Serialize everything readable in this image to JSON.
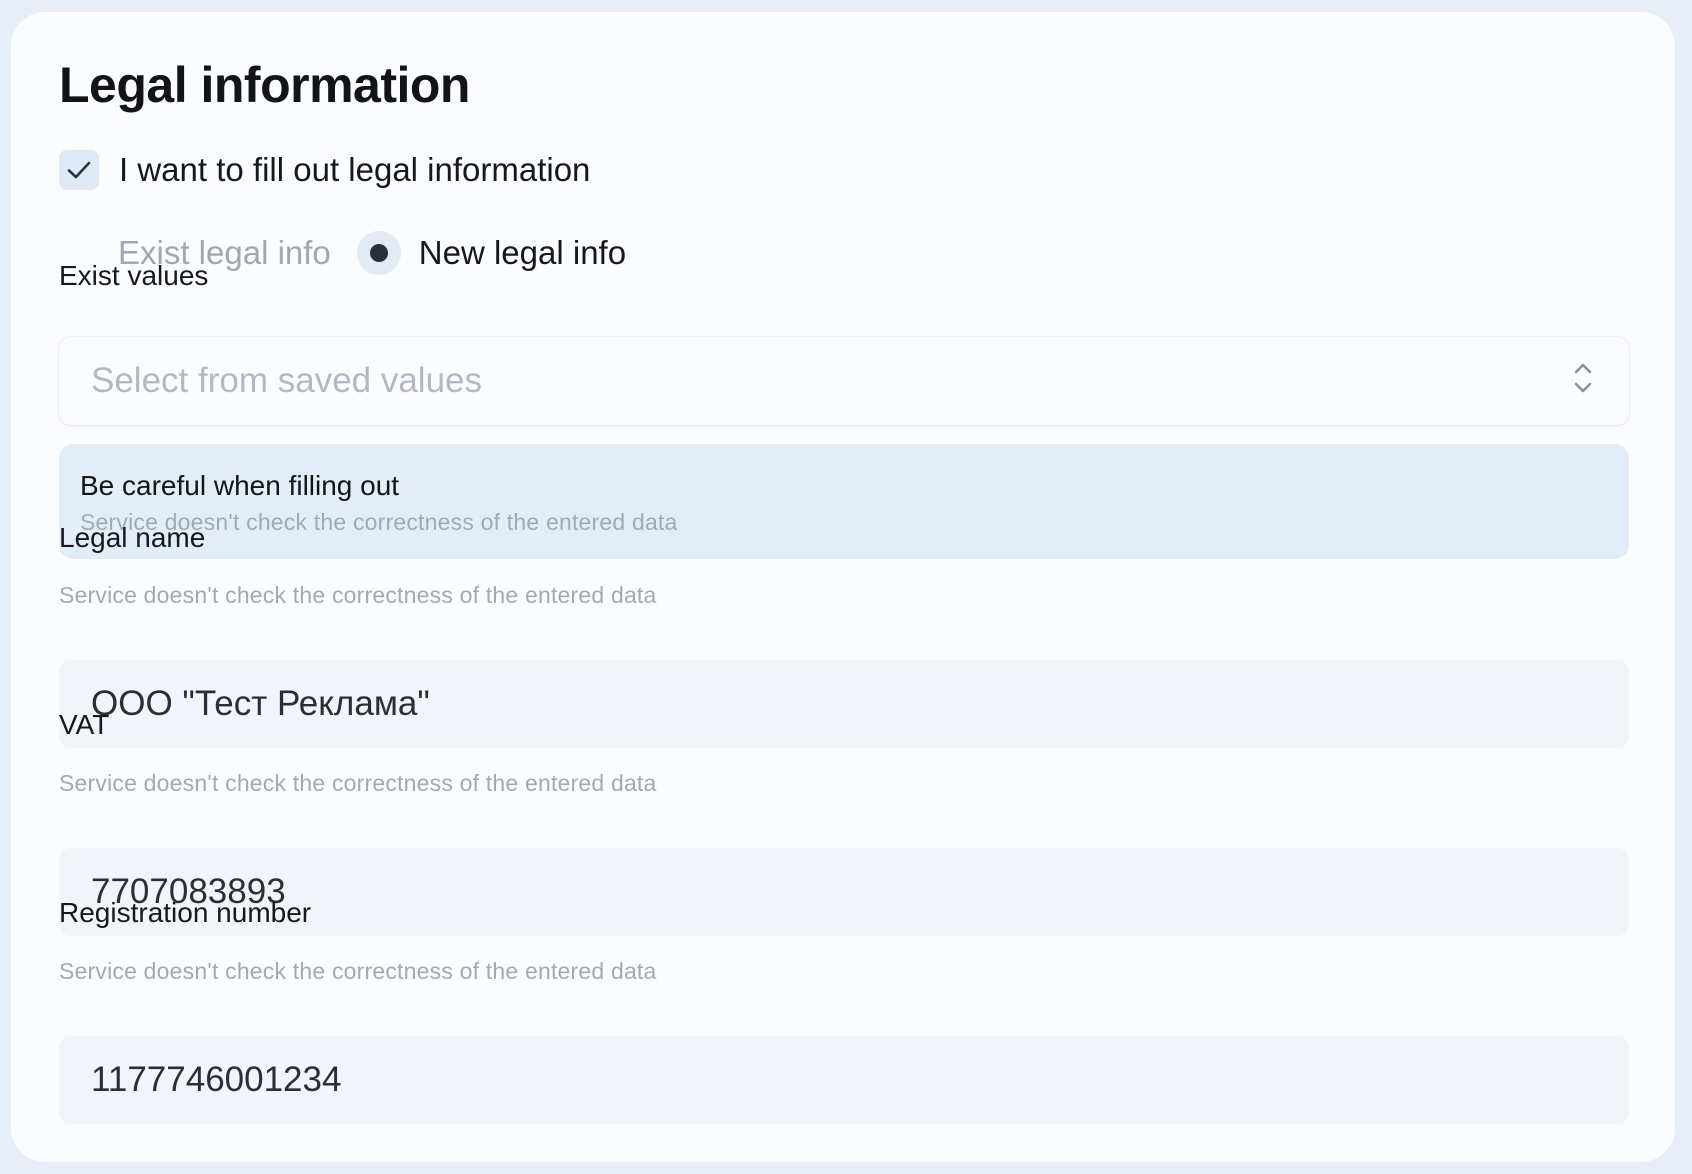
{
  "form": {
    "title": "Legal information",
    "checkbox": {
      "label": "I want to fill out legal information",
      "checked": true,
      "icon": "check-icon"
    },
    "radio": {
      "options": [
        {
          "label": "Exist legal info",
          "selected": false
        },
        {
          "label": "New legal info",
          "selected": true
        }
      ]
    },
    "exist_values": {
      "label": "Exist values",
      "placeholder": "Select from saved values",
      "icon": "chevron-up-down-icon"
    },
    "alert": {
      "title": "Be careful when filling out",
      "description": "Service doesn't check the correctness of the entered data"
    },
    "fields": {
      "legal_name": {
        "label": "Legal name",
        "hint": "Service doesn't check the correctness of the entered data",
        "value": "ООО \"Тест Реклама\""
      },
      "vat": {
        "label": "VAT",
        "hint": "Service doesn't check the correctness of the entered data",
        "value": "7707083893"
      },
      "registration_number": {
        "label": "Registration number",
        "hint": "Service doesn't check the correctness of the entered data",
        "value": "1177746001234"
      }
    }
  }
}
